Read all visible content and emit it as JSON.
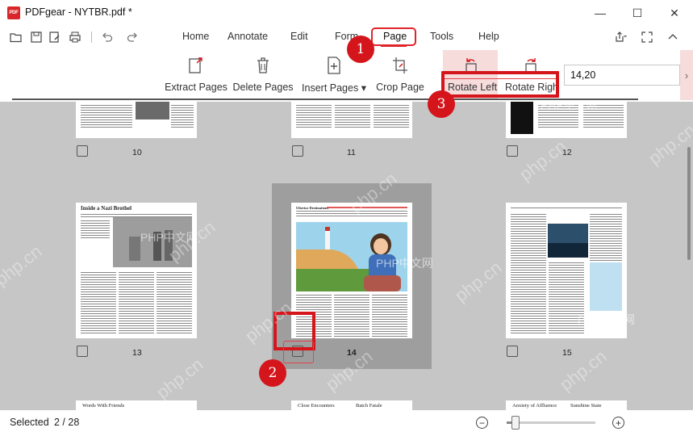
{
  "window": {
    "title": "PDFgear - NYTBR.pdf *",
    "logo_text": "PDF",
    "controls": {
      "minimize": "—",
      "maximize": "☐",
      "close": "✕"
    }
  },
  "menu": {
    "tabs": [
      "Home",
      "Annotate",
      "Edit",
      "Form",
      "Page",
      "Tools",
      "Help"
    ],
    "active_tab": "Page"
  },
  "ribbon": {
    "extract_pages": "Extract Pages",
    "delete_pages": "Delete Pages",
    "insert_pages": "Insert Pages",
    "insert_pages_arrow": "▾",
    "crop_page": "Crop Page",
    "rotate_left": "Rotate Left",
    "rotate_right": "Rotate Righ",
    "page_range_value": "14,20",
    "scroll_right": "›"
  },
  "pages": {
    "top_row": [
      "10",
      "11",
      "12"
    ],
    "middle_row": [
      "13",
      "14",
      "15"
    ],
    "selected_page": "14",
    "page13_headline": "Inside a Nazi Brothel",
    "page14_headline": "Ulterior Destinations",
    "bottom_row_headlines": [
      "Words With Friends",
      "Close Encounters",
      "Batch Fatale",
      "Anxiety of Affluence",
      "Sunshine State"
    ]
  },
  "annotations": {
    "badges": [
      "1",
      "2",
      "3"
    ],
    "colors": {
      "badge": "#d4151b",
      "highlight": "#f7dcdc"
    }
  },
  "watermarks": [
    "php.cn",
    "PHP中文网"
  ],
  "status": {
    "selected_label": "Selected",
    "selected_count": "2  /  28",
    "zoom_out": "−",
    "zoom_in": "+",
    "zoom_level": 0.1
  }
}
